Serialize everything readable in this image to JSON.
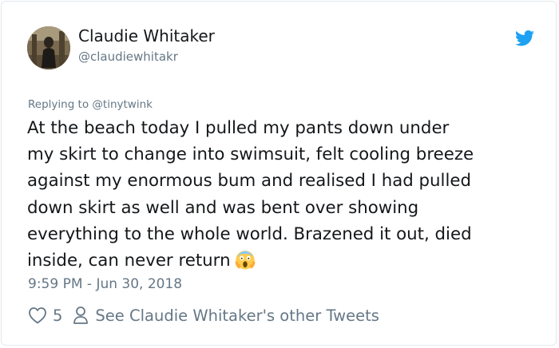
{
  "tweet": {
    "author": {
      "display_name": "Claudie Whitaker",
      "handle": "@claudiewhitakr"
    },
    "reply_to": "Replying to @tinytwink",
    "text_lines": [
      "At the beach today I pulled my pants down under",
      "my skirt to change into swimsuit, felt cooling breeze",
      "against my enormous bum and realised I had pulled",
      "down skirt as well and was bent over showing",
      "everything to the whole world. Brazened it out, died",
      "inside, can never return"
    ],
    "emoji": "face-screaming-in-fear-emoji",
    "timestamp": "9:59 PM - Jun 30, 2018",
    "likes": "5",
    "other_tweets_link": "See Claudie Whitaker's other Tweets"
  },
  "icons": {
    "brand": "twitter-bird-icon",
    "like": "heart-outline-icon",
    "profile": "person-outline-icon"
  },
  "colors": {
    "twitter_blue": "#1da1f2",
    "primary_text": "#14171a",
    "secondary_text": "#657786",
    "border": "#e1e8ed"
  }
}
